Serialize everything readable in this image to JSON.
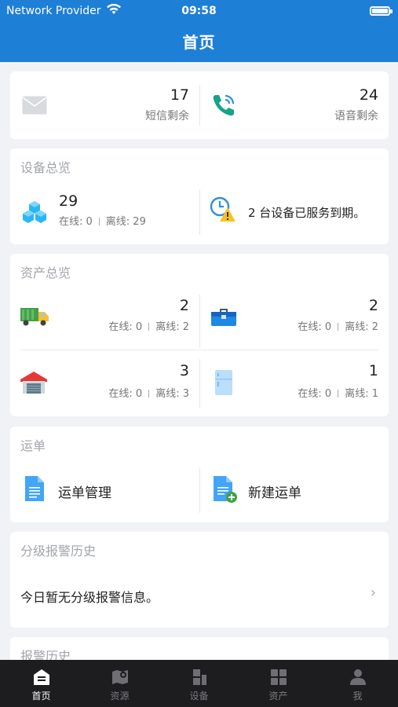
{
  "status_bar": {
    "carrier": "Network Provider",
    "time": "09:58"
  },
  "nav": {
    "title": "首页"
  },
  "sms": {
    "count": "17",
    "label": "短信剩余"
  },
  "voice": {
    "count": "24",
    "label": "语音剩余"
  },
  "devices": {
    "title": "设备总览",
    "total": "29",
    "online": "在线: 0",
    "offline": "离线: 29",
    "expiry_notice": "2 台设备已服务到期。"
  },
  "assets": {
    "title": "资产总览",
    "items": [
      {
        "name": "truck",
        "count": "2",
        "online": "在线: 0",
        "offline": "离线: 2"
      },
      {
        "name": "toolbox",
        "count": "2",
        "online": "在线: 0",
        "offline": "离线: 2"
      },
      {
        "name": "warehouse",
        "count": "3",
        "online": "在线: 0",
        "offline": "离线: 3"
      },
      {
        "name": "refrigerator",
        "count": "1",
        "online": "在线: 0",
        "offline": "离线: 1"
      }
    ]
  },
  "waybill": {
    "title": "运单",
    "manage": "运单管理",
    "create": "新建运单"
  },
  "graded_alarm": {
    "title": "分级报警历史",
    "message": "今日暂无分级报警信息。"
  },
  "alarm_history": {
    "title": "报警历史"
  },
  "tabs": [
    {
      "label": "首页",
      "icon": "home-icon",
      "active": true
    },
    {
      "label": "资源",
      "icon": "map-pin-icon"
    },
    {
      "label": "设备",
      "icon": "device-icon"
    },
    {
      "label": "资产",
      "icon": "grid-icon"
    },
    {
      "label": "我",
      "icon": "person-icon"
    }
  ],
  "colors": {
    "brand": "#1e7fd6",
    "tabbar": "#1d1d1f"
  }
}
